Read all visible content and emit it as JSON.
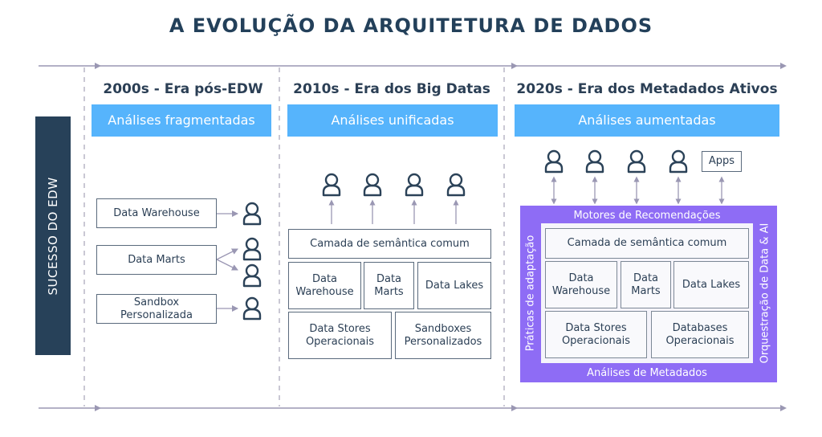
{
  "title": "A EVOLUÇÃO DA ARQUITETURA DE DADOS",
  "side_label": "SUCESSO DO  EDW",
  "colors": {
    "title": "#23405a",
    "banner": "#56b4fc",
    "side_bar": "#274159",
    "purple": "#8e6cf5",
    "arrow": "#9a97b3"
  },
  "eras": [
    {
      "title": "2000s - Era pós-EDW",
      "banner": "Análises fragmentadas",
      "boxes": [
        "Data Warehouse",
        "Data Marts",
        "Sandbox\nPersonalizada"
      ]
    },
    {
      "title": "2010s - Era dos Big Datas",
      "banner": "Análises unificadas",
      "semantic_layer": "Camada de semântica comum",
      "row1": [
        "Data\nWarehouse",
        "Data\nMarts",
        "Data Lakes"
      ],
      "row2": [
        "Data Stores\nOperacionais",
        "Sandboxes\nPersonalizados"
      ]
    },
    {
      "title": "2020s - Era dos Metadados Ativos",
      "banner": "Análises aumentadas",
      "apps": "Apps",
      "top_label": "Motores de Recomendações",
      "bottom_label": "Análises de Metadados",
      "left_label": "Práticas de adaptação",
      "right_label": "Orquestração de Data & AI",
      "semantic_layer": "Camada de semântica comum",
      "row1": [
        "Data\nWarehouse",
        "Data\nMarts",
        "Data Lakes"
      ],
      "row2": [
        "Data Stores\nOperacionais",
        "Databases\nOperacionais"
      ]
    }
  ]
}
